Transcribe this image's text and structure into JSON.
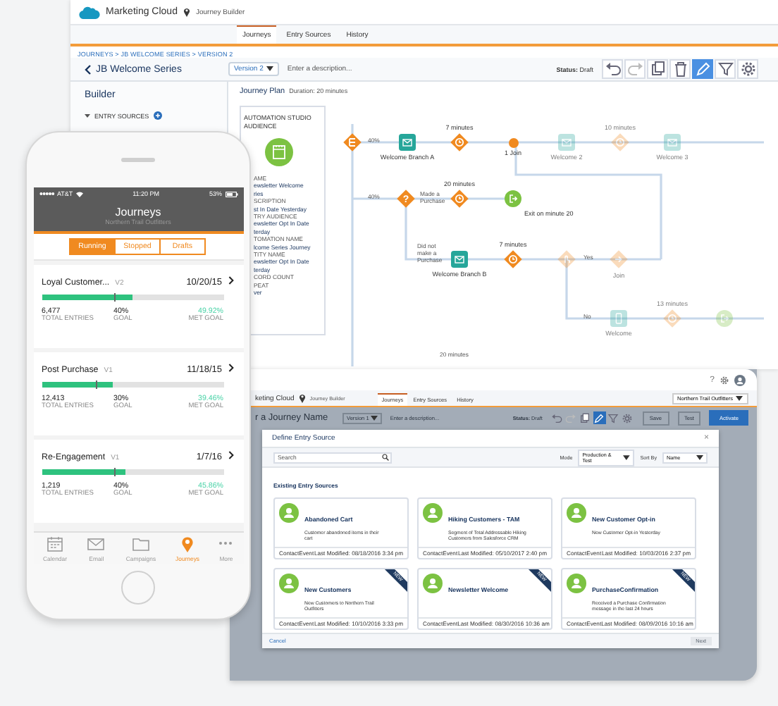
{
  "builder": {
    "app_name": "Marketing Cloud",
    "app_section": "Journey Builder",
    "tabs": [
      {
        "label": "Journeys",
        "selected": true
      },
      {
        "label": "Entry Sources",
        "selected": false
      },
      {
        "label": "History",
        "selected": false
      }
    ],
    "breadcrumb": "JOURNEYS > JB WELCOME SERIES > VERSION 2",
    "title": "JB Welcome Series",
    "version": "Version 2",
    "description": {
      "placeholder": "Enter a description..."
    },
    "status_label": "Status:",
    "status": "Draft",
    "edit_mode": true,
    "sidebar": {
      "title": "Builder",
      "section": "ENTRY SOURCES"
    },
    "plan_title": "Journey Plan",
    "plan_duration": "Duration: 20 minutes",
    "entry_card": {
      "heading": "AUTOMATION STUDIO AUDIENCE",
      "lines": [
        {
          "kind": "label",
          "text": "AME"
        },
        {
          "kind": "value",
          "text": "ewsletter Welcome"
        },
        {
          "kind": "value",
          "text": "ries"
        },
        {
          "kind": "label",
          "text": "SCRIPTION"
        },
        {
          "kind": "value",
          "text": "st In Date Yesterday"
        },
        {
          "kind": "label",
          "text": "TRY AUDIENCE"
        },
        {
          "kind": "value",
          "text": "ewsletter Opt In Date"
        },
        {
          "kind": "value",
          "text": "terday"
        },
        {
          "kind": "label",
          "text": "TOMATION NAME"
        },
        {
          "kind": "value",
          "text": "lcome Series Journey"
        },
        {
          "kind": "label",
          "text": "TITY NAME"
        },
        {
          "kind": "value",
          "text": "ewsletter Opt In Date"
        },
        {
          "kind": "value",
          "text": "terday"
        },
        {
          "kind": "label",
          "text": "CORD COUNT"
        },
        {
          "kind": "label",
          "text": "PEAT"
        },
        {
          "kind": "value",
          "text": "ver"
        }
      ]
    },
    "flow": {
      "nodes": [
        {
          "kind": "split",
          "faded": false
        },
        {
          "kind": "email",
          "label": "Welcome Branch A",
          "faded": false
        },
        {
          "kind": "wait",
          "label": "7 minutes",
          "faded": false
        },
        {
          "kind": "join",
          "label": "1 Join",
          "faded": false
        },
        {
          "kind": "email",
          "label": "Welcome 2",
          "faded": true
        },
        {
          "kind": "wait",
          "label": "10 minutes",
          "faded": true
        },
        {
          "kind": "email",
          "label": "Welcome 3",
          "faded": true
        },
        {
          "kind": "decision",
          "symbol": "?",
          "faded": false
        },
        {
          "kind": "wait",
          "label": "20 minutes",
          "faded": false
        },
        {
          "kind": "exit",
          "label": "Exit on minute 20",
          "faded": false
        },
        {
          "kind": "email",
          "label": "Welcome Branch B",
          "faded": false
        },
        {
          "kind": "wait",
          "label": "7 minutes",
          "faded": false
        },
        {
          "kind": "engagement",
          "faded": true
        },
        {
          "kind": "rejoin",
          "label": "Join",
          "faded": true
        },
        {
          "kind": "sms",
          "label": "Welcome",
          "faded": true
        },
        {
          "kind": "wait",
          "label": "13 minutes",
          "faded": true
        },
        {
          "kind": "exit",
          "faded": true
        }
      ],
      "labels": [
        "40%",
        "40%",
        "Made a Purchase",
        "Did not make a Purchase",
        "Yes",
        "No",
        "20 minutes"
      ]
    }
  },
  "entry_window": {
    "help": "?",
    "app_name": "keting Cloud",
    "app_section": "Journey Builder",
    "tabs": [
      {
        "label": "Journeys",
        "selected": true
      },
      {
        "label": "Entry Sources",
        "selected": false
      },
      {
        "label": "History",
        "selected": false
      }
    ],
    "org": "Northern Trail Outfitters",
    "title": "r a Journey Name",
    "version": "Version 1",
    "description": {
      "placeholder": "Enter a description..."
    },
    "status_label": "Status:",
    "status": "Draft",
    "edit_mode": true,
    "buttons": [
      {
        "label": "Save",
        "kind": "secondary"
      },
      {
        "label": "Test",
        "kind": "secondary"
      },
      {
        "label": "Activate",
        "kind": "primary"
      }
    ],
    "modal": {
      "title": "Define Entry Source",
      "close": "×",
      "search": {
        "placeholder": "Search"
      },
      "mode_label": "Mode",
      "mode": "Production & Test",
      "sort_label": "Sort By",
      "sort": "Name",
      "section": "Existing Entry Sources",
      "sources": [
        {
          "title": "Abandoned Cart",
          "description": "Customer abandoned items in their cart",
          "type": "ContactEvent",
          "modified": "Last Modified: 08/18/2016 3:34 pm"
        },
        {
          "title": "Hiking Customers - TAM",
          "description": "Segment of Total Addressable Hiking Customers from Salesforce CRM",
          "type": "ContactEvent",
          "modified": "Last Modified: 05/10/2017 2:40 pm"
        },
        {
          "title": "New Customer Opt-in",
          "description": "New Customer Opt-in Yesterday",
          "type": "ContactEvent",
          "modified": "Last Modified: 10/03/2016 2:37 pm"
        },
        {
          "title": "New Customers",
          "description": "New Customers to Northern Trail Outfitters",
          "type": "ContactEvent",
          "modified": "Last Modified: 10/10/2016 3:33 pm",
          "badge": "NEW"
        },
        {
          "title": "Newsletter Welcome",
          "type": "ContactEvent",
          "modified": "Last Modified: 08/30/2016 10:36 am",
          "badge": "NEW"
        },
        {
          "title": "PurchaseConfirmation",
          "description": "Received a Purchase Confirmation message in the last 24 hours",
          "type": "ContactEvent",
          "modified": "Last Modified: 08/09/2016 10:16 am",
          "badge": "NEW"
        }
      ],
      "cancel": "Cancel",
      "next": {
        "label": "Next",
        "disabled": true
      }
    }
  },
  "phone": {
    "carrier": "AT&T",
    "time": "11:20 PM",
    "battery": "53%",
    "title": "Journeys",
    "subtitle": "Northern Trail Outfitters",
    "segments": [
      {
        "label": "Running",
        "selected": true
      },
      {
        "label": "Stopped",
        "selected": false
      },
      {
        "label": "Drafts",
        "selected": false
      }
    ],
    "journeys": [
      {
        "name": "Loyal Customer...",
        "version": "V2",
        "date": "10/20/15",
        "level": 0.4992,
        "entries": "6,477",
        "entries_label": "TOTAL ENTRIES",
        "goal": "40%",
        "goal_label": "GOAL",
        "met": "49.92%",
        "met_label": "MET GOAL"
      },
      {
        "name": "Post Purchase",
        "version": "V1",
        "date": "11/18/15",
        "level": 0.3946,
        "entries": "12,413",
        "entries_label": "TOTAL ENTRIES",
        "goal": "30%",
        "goal_label": "GOAL",
        "met": "39.46%",
        "met_label": "MET GOAL"
      },
      {
        "name": "Re-Engagement",
        "version": "V1",
        "date": "1/7/16",
        "level": 0.4586,
        "entries": "1,219",
        "entries_label": "TOTAL ENTRIES",
        "goal": "40%",
        "goal_label": "GOAL",
        "met": "45.86%",
        "met_label": "MET GOAL"
      }
    ],
    "tabs": [
      {
        "label": "Calendar",
        "selected": false
      },
      {
        "label": "Email",
        "selected": false
      },
      {
        "label": "Campaigns",
        "selected": false
      },
      {
        "label": "Journeys",
        "selected": true
      },
      {
        "label": "More",
        "selected": false
      }
    ]
  }
}
